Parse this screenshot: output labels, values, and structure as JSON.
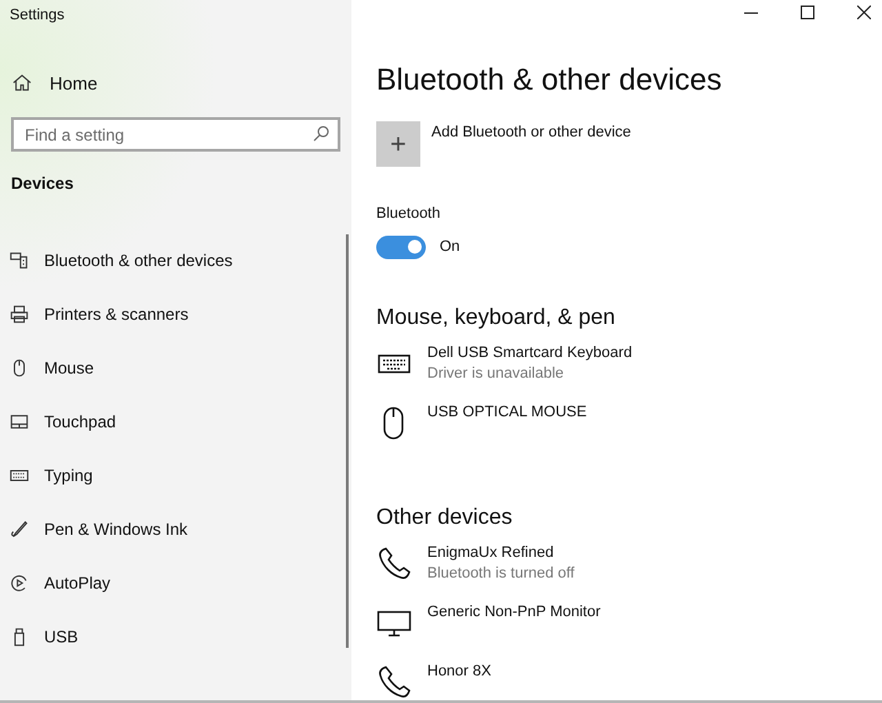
{
  "window": {
    "title": "Settings",
    "controls": [
      {
        "kind": "minimize"
      },
      {
        "kind": "maximize"
      },
      {
        "kind": "close"
      }
    ]
  },
  "sidebar": {
    "home": "Home",
    "search": {
      "placeholder": "Find a setting"
    },
    "section": "Devices",
    "items": [
      {
        "label": "Bluetooth & other devices",
        "kind": "bluetooth"
      },
      {
        "label": "Printers & scanners",
        "kind": "printer"
      },
      {
        "label": "Mouse",
        "kind": "mouse"
      },
      {
        "label": "Touchpad",
        "kind": "touchpad"
      },
      {
        "label": "Typing",
        "kind": "typing"
      },
      {
        "label": "Pen & Windows Ink",
        "kind": "pen"
      },
      {
        "label": "AutoPlay",
        "kind": "autoplay"
      },
      {
        "label": "USB",
        "kind": "usb"
      }
    ]
  },
  "page": {
    "title": "Bluetooth & other devices",
    "add_button": {
      "label": "+",
      "text": "Add Bluetooth or other device"
    },
    "bluetooth": {
      "label": "Bluetooth",
      "on": true,
      "state_text": "On"
    },
    "sections": [
      {
        "title": "Mouse, keyboard, & pen",
        "devices": [
          {
            "name": "Dell USB Smartcard Keyboard",
            "status": "Driver is unavailable",
            "kind": "keyboard"
          },
          {
            "name": "USB OPTICAL MOUSE",
            "kind": "mouse"
          }
        ]
      },
      {
        "title": "Other devices",
        "devices": [
          {
            "name": "EnigmaUx Refined",
            "status": "Bluetooth is turned off",
            "kind": "phone"
          },
          {
            "name": "Generic Non-PnP Monitor",
            "kind": "monitor"
          },
          {
            "name": "Honor 8X",
            "kind": "phone"
          }
        ]
      }
    ]
  }
}
